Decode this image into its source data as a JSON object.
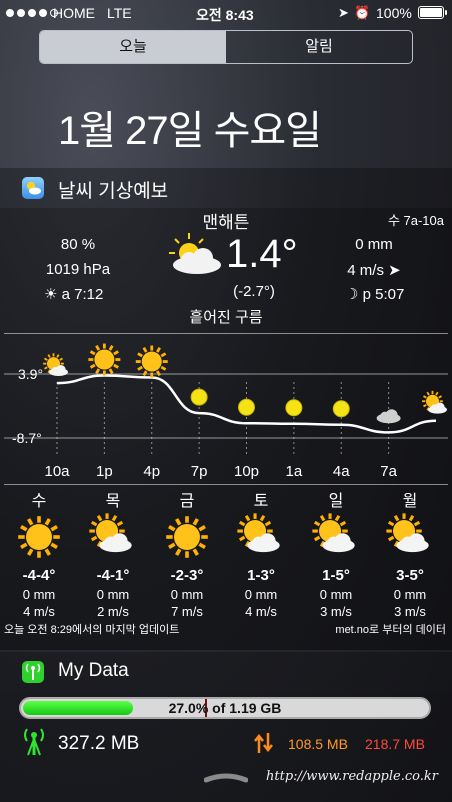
{
  "status": {
    "carrier": "HOME",
    "network": "LTE",
    "time": "오전 8:43",
    "battery": "100%",
    "signal_bars": 4
  },
  "tabs": [
    {
      "label": "오늘",
      "active": true
    },
    {
      "label": "알림",
      "active": false
    }
  ],
  "date": "1월 27일 수요일",
  "weather_widget": {
    "title": "날씨 기상예보",
    "location": "맨해튼",
    "range": "수 7a-10a",
    "humidity": "80 %",
    "pressure": "1019 hPa",
    "sunrise": "a 7:12",
    "temp": "1.4°",
    "feels": "(-2.7°)",
    "desc": "흩어진 구름",
    "precip": "0 mm",
    "wind": "4 m/s ➤",
    "moonset": "p 5:07",
    "chart_data": {
      "type": "line",
      "y_max_label": "3.9°",
      "y_min_label": "-8.7°",
      "ylim": [
        -8.7,
        3.9
      ],
      "x_ticks": [
        "10a",
        "1p",
        "4p",
        "7p",
        "10p",
        "1a",
        "4a",
        "7a"
      ],
      "x": [
        0,
        3,
        6,
        9,
        12,
        15,
        18,
        21,
        24
      ],
      "y": [
        2.1,
        3.6,
        3.2,
        -3.8,
        -5.8,
        -5.9,
        -6.1,
        -7.6,
        -5.3
      ],
      "icons": [
        "partly-cloudy-icon",
        "sun-icon",
        "sun-icon",
        "moon-icon",
        "moon-icon",
        "moon-icon",
        "moon-icon",
        "cloud-icon",
        "partly-sunny-icon"
      ]
    },
    "forecast": [
      {
        "day": "수",
        "icon": "sun-icon",
        "temp": "-4-4°",
        "precip": "0 mm",
        "wind": "4 m/s"
      },
      {
        "day": "목",
        "icon": "partly-cloudy-icon",
        "temp": "-4-1°",
        "precip": "0 mm",
        "wind": "2 m/s"
      },
      {
        "day": "금",
        "icon": "sun-icon",
        "temp": "-2-3°",
        "precip": "0 mm",
        "wind": "7 m/s"
      },
      {
        "day": "토",
        "icon": "partly-cloudy-icon",
        "temp": "1-3°",
        "precip": "0 mm",
        "wind": "4 m/s"
      },
      {
        "day": "일",
        "icon": "partly-cloudy-icon",
        "temp": "1-5°",
        "precip": "0 mm",
        "wind": "3 m/s"
      },
      {
        "day": "월",
        "icon": "partly-cloudy-icon",
        "temp": "3-5°",
        "precip": "0 mm",
        "wind": "3 m/s"
      }
    ],
    "updated": "오늘 오전 8:29에서의 마지막 업데이트",
    "source": "met.no로 부터의 데이터"
  },
  "mydata": {
    "title": "My Data",
    "usage_text": "27.0% of 1.19 GB",
    "usage_fraction": 0.27,
    "total": "327.2 MB",
    "down": "108.5 MB",
    "up": "218.7 MB"
  },
  "watermark": "http://www.redapple.co.kr",
  "colors": {
    "accent_red": "#ff5a3c",
    "sun_yellow": "#ffd21a",
    "data_green": "#2ee52e"
  }
}
